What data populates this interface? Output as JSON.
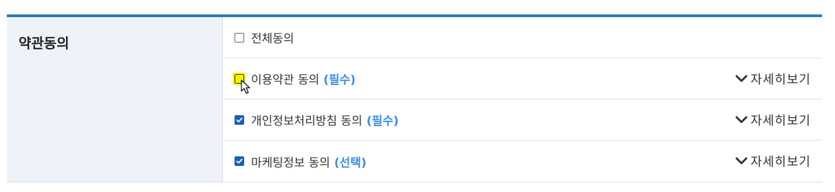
{
  "section": {
    "label": "약관동의"
  },
  "agree_all": {
    "label": "전체동의",
    "checked": false
  },
  "terms": [
    {
      "label": "이용약관 동의",
      "tag": "(필수)",
      "checked": false,
      "detail_label": "자세히보기"
    },
    {
      "label": "개인정보처리방침 동의",
      "tag": "(필수)",
      "checked": true,
      "detail_label": "자세히보기"
    },
    {
      "label": "마케팅정보 동의",
      "tag": "(선택)",
      "checked": true,
      "detail_label": "자세히보기"
    }
  ],
  "colors": {
    "top_border": "#2e7bb4",
    "label_bg": "#eef3fa",
    "tag": "#3d8de6",
    "checkbox_checked": "#1c5fb6",
    "highlight": "#f6f000"
  }
}
